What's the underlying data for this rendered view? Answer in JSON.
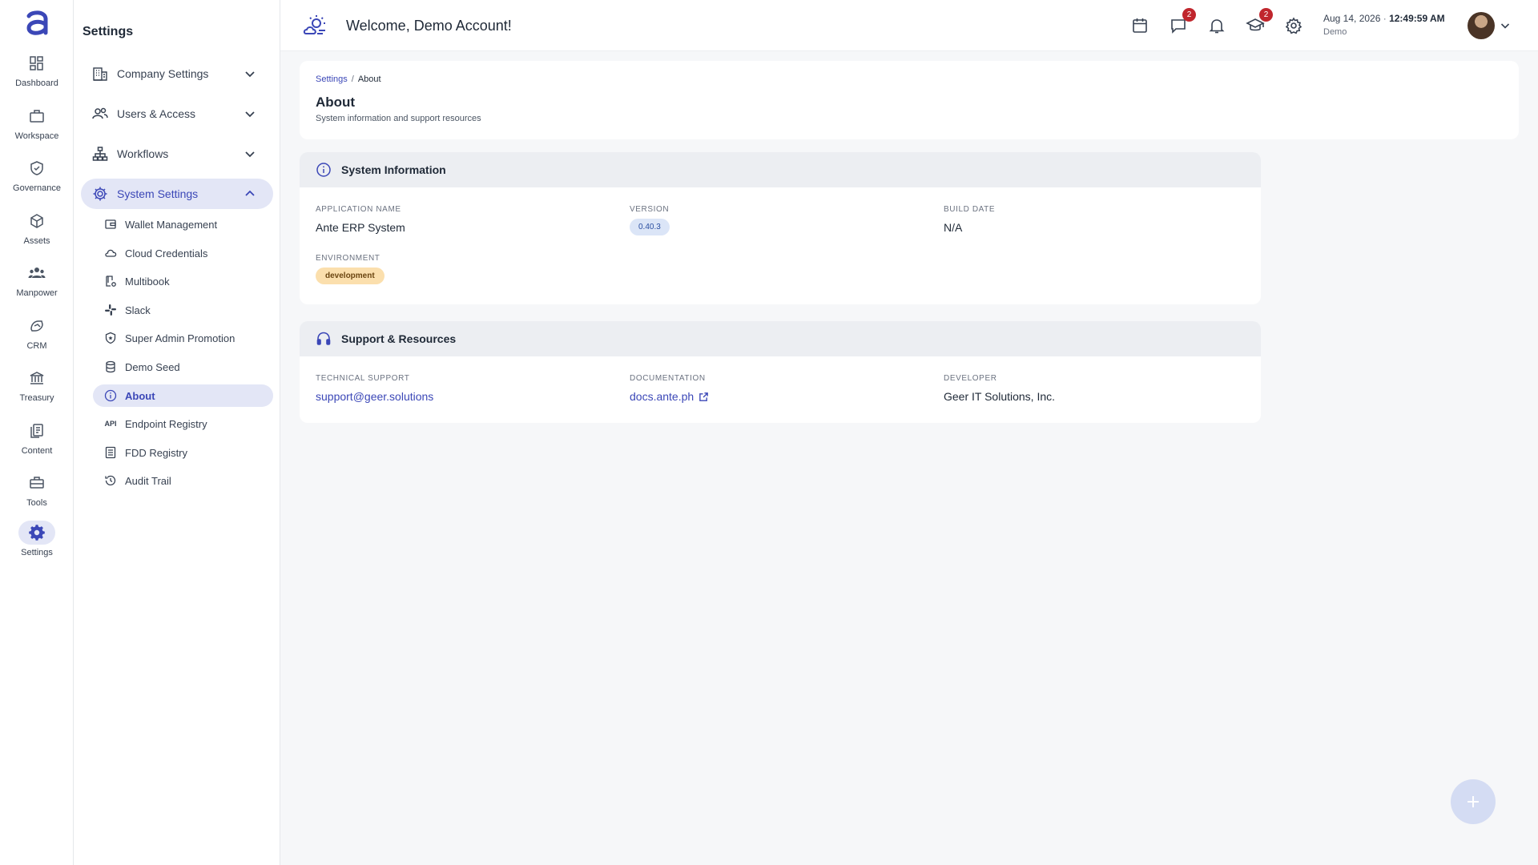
{
  "rail": {
    "items": [
      {
        "label": "Dashboard",
        "icon": "dashboard-icon"
      },
      {
        "label": "Workspace",
        "icon": "briefcase-icon"
      },
      {
        "label": "Governance",
        "icon": "shield-check-icon"
      },
      {
        "label": "Assets",
        "icon": "cube-icon"
      },
      {
        "label": "Manpower",
        "icon": "people-icon"
      },
      {
        "label": "CRM",
        "icon": "handshake-icon"
      },
      {
        "label": "Treasury",
        "icon": "bank-icon"
      },
      {
        "label": "Content",
        "icon": "documents-icon"
      },
      {
        "label": "Tools",
        "icon": "toolbox-icon"
      },
      {
        "label": "Settings",
        "icon": "gear-icon",
        "active": true
      }
    ]
  },
  "settings_nav": {
    "title": "Settings",
    "groups": [
      {
        "label": "Company Settings",
        "icon": "building-icon"
      },
      {
        "label": "Users & Access",
        "icon": "users-icon"
      },
      {
        "label": "Workflows",
        "icon": "hierarchy-icon"
      },
      {
        "label": "System Settings",
        "icon": "gear-icon",
        "open": true
      }
    ],
    "sub_items": [
      {
        "label": "Wallet Management",
        "icon": "wallet-icon"
      },
      {
        "label": "Cloud Credentials",
        "icon": "cloud-icon"
      },
      {
        "label": "Multibook",
        "icon": "book-gear-icon"
      },
      {
        "label": "Slack",
        "icon": "slack-icon"
      },
      {
        "label": "Super Admin Promotion",
        "icon": "shield-star-icon"
      },
      {
        "label": "Demo Seed",
        "icon": "database-icon"
      },
      {
        "label": "About",
        "icon": "info-icon",
        "active": true
      },
      {
        "label": "Endpoint Registry",
        "icon": "api-icon",
        "icon_text": "API"
      },
      {
        "label": "FDD Registry",
        "icon": "list-doc-icon"
      },
      {
        "label": "Audit Trail",
        "icon": "history-icon"
      }
    ]
  },
  "topbar": {
    "welcome": "Welcome, Demo Account!",
    "chat_badge": "2",
    "learning_badge": "2",
    "date": "Aug 14, 2026",
    "time": "12:49:59 AM",
    "user": "Demo"
  },
  "page": {
    "breadcrumb": {
      "parent": "Settings",
      "separator": "/",
      "current": "About"
    },
    "title": "About",
    "subtitle": "System information and support resources"
  },
  "system_info": {
    "title": "System Information",
    "app_name_label": "APPLICATION NAME",
    "app_name": "Ante ERP System",
    "version_label": "VERSION",
    "version": "0.40.3",
    "build_date_label": "BUILD DATE",
    "build_date": "N/A",
    "environment_label": "ENVIRONMENT",
    "environment": "development"
  },
  "support": {
    "title": "Support & Resources",
    "tech_label": "TECHNICAL SUPPORT",
    "tech_email": "support@geer.solutions",
    "docs_label": "DOCUMENTATION",
    "docs_link": "docs.ante.ph",
    "dev_label": "DEVELOPER",
    "developer": "Geer IT Solutions, Inc."
  },
  "fab": {
    "symbol": "+"
  },
  "colors": {
    "accent": "#3b47b7",
    "accent_soft": "#e3e6f6",
    "badge": "#c0262d",
    "env_pill": "#fbdfad",
    "version_pill": "#dbe5f7"
  }
}
